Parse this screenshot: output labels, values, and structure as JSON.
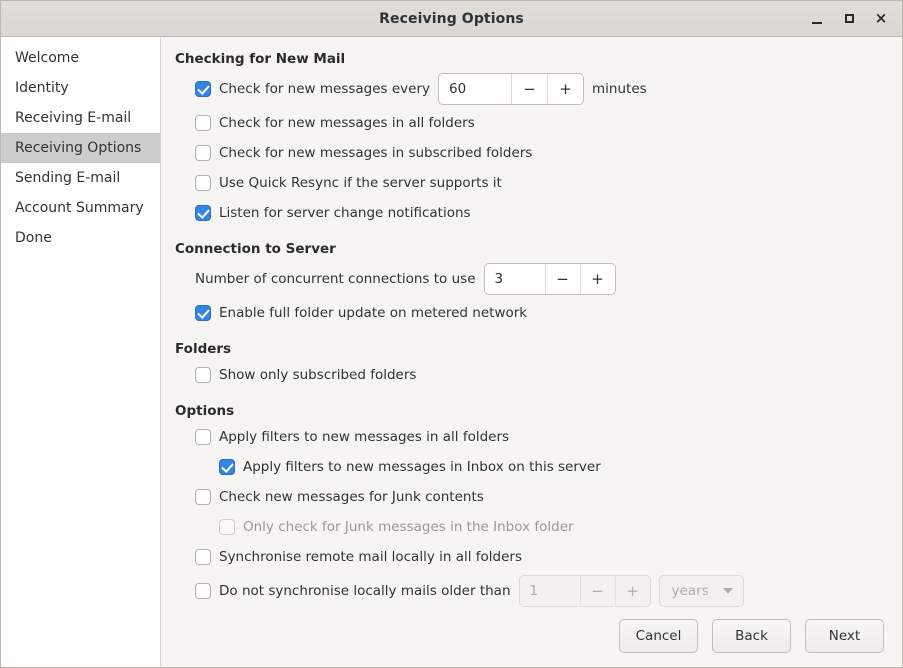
{
  "window": {
    "title": "Receiving Options",
    "controls": {
      "minimize": "_",
      "maximize": "□",
      "close": "×"
    }
  },
  "sidebar": {
    "items": [
      {
        "label": "Welcome",
        "selected": false
      },
      {
        "label": "Identity",
        "selected": false
      },
      {
        "label": "Receiving E-mail",
        "selected": false
      },
      {
        "label": "Receiving Options",
        "selected": true
      },
      {
        "label": "Sending E-mail",
        "selected": false
      },
      {
        "label": "Account Summary",
        "selected": false
      },
      {
        "label": "Done",
        "selected": false
      }
    ]
  },
  "sections": {
    "checking": {
      "heading": "Checking for New Mail",
      "check_every_label": "Check for new messages every",
      "check_every_checked": true,
      "interval_value": "60",
      "interval_minus": "−",
      "interval_plus": "+",
      "minutes_label": "minutes",
      "all_folders_label": "Check for new messages in all folders",
      "subscribed_folders_label": "Check for new messages in subscribed folders",
      "quick_resync_label": "Use Quick Resync if the server supports it",
      "listen_label": "Listen for server change notifications"
    },
    "connection": {
      "heading": "Connection to Server",
      "concurrent_label": "Number of concurrent connections to use",
      "concurrent_value": "3",
      "concurrent_minus": "−",
      "concurrent_plus": "+",
      "metered_label": "Enable full folder update on metered network"
    },
    "folders": {
      "heading": "Folders",
      "show_subscribed_label": "Show only subscribed folders"
    },
    "options": {
      "heading": "Options",
      "filters_all_label": "Apply filters to new messages in all folders",
      "filters_inbox_label": "Apply filters to new messages in Inbox on this server",
      "junk_label": "Check new messages for Junk contents",
      "junk_inbox_label": "Only check for Junk messages in the Inbox folder",
      "sync_remote_label": "Synchronise remote mail locally in all folders",
      "no_sync_older_label": "Do not synchronise locally mails older than",
      "age_value": "1",
      "age_minus": "−",
      "age_plus": "+",
      "age_unit": "years"
    }
  },
  "footer": {
    "cancel": "Cancel",
    "back": "Back",
    "next": "Next"
  },
  "colors": {
    "accent": "#3584e4",
    "window_bg": "#f6f5f4",
    "sidebar_bg": "#ffffff",
    "selected_row": "#cdcdcd",
    "disabled_text": "#9a9996"
  }
}
